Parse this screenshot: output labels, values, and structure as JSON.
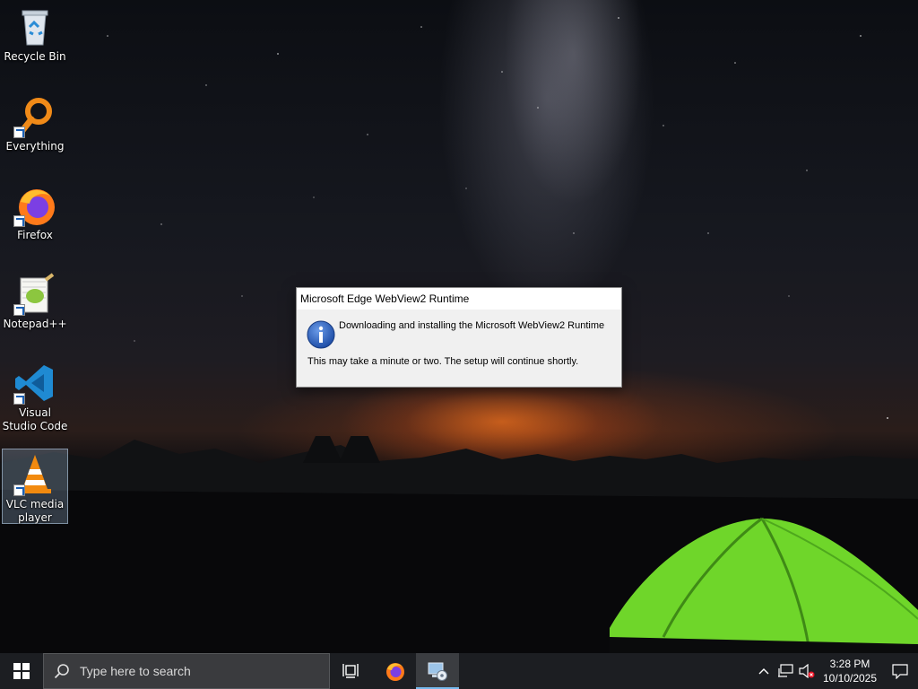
{
  "desktop": {
    "icons": [
      {
        "label": "Recycle Bin",
        "icon": "recycle-bin-icon"
      },
      {
        "label": "Everything",
        "icon": "everything-search-icon"
      },
      {
        "label": "Firefox",
        "icon": "firefox-icon"
      },
      {
        "label": "Notepad++",
        "icon": "notepad-plus-plus-icon"
      },
      {
        "label": "Visual Studio Code",
        "icon": "vscode-icon"
      },
      {
        "label": "VLC media player",
        "icon": "vlc-icon",
        "selected": true
      }
    ]
  },
  "dialog": {
    "title": "Microsoft Edge WebView2 Runtime",
    "message": "Downloading and installing the Microsoft WebView2 Runtime",
    "detail": "This may take a minute or two. The setup will continue shortly.",
    "icon": "info-icon"
  },
  "taskbar": {
    "search_placeholder": "Type here to search",
    "pinned": [
      {
        "name": "task-view",
        "icon": "task-view-icon"
      },
      {
        "name": "firefox",
        "icon": "firefox-icon"
      },
      {
        "name": "installer",
        "icon": "installer-icon",
        "active": true
      }
    ],
    "tray": {
      "time": "3:28 PM",
      "date": "10/10/2025",
      "icons": [
        "chevron-up-icon",
        "network-icon",
        "volume-muted-icon",
        "notifications-icon"
      ]
    }
  },
  "colors": {
    "taskbar_bg": "#1c1e22",
    "accent": "#76b9ed",
    "dialog_bg": "#f0f0f0",
    "info_blue": "#1f4fa8",
    "tent_green": "#7be02a"
  }
}
